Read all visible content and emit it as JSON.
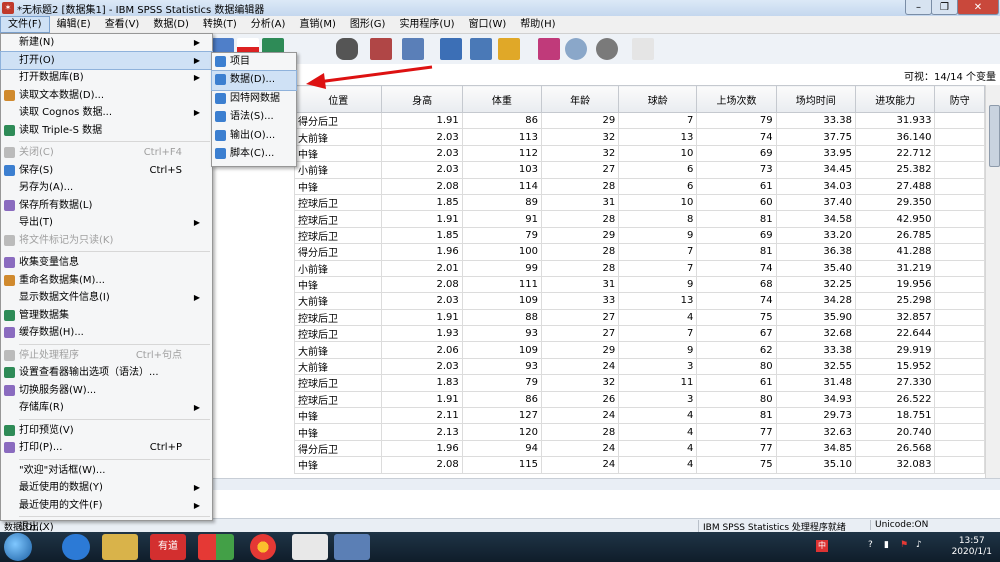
{
  "window": {
    "title": "*无标题2 [数据集1] - IBM SPSS Statistics 数据编辑器"
  },
  "menubar": [
    "文件(F)",
    "编辑(E)",
    "查看(V)",
    "数据(D)",
    "转换(T)",
    "分析(A)",
    "直销(M)",
    "图形(G)",
    "实用程序(U)",
    "窗口(W)",
    "帮助(H)"
  ],
  "visible_vars": "可视：14/14 个变量",
  "file_menu": [
    {
      "label": "新建(N)",
      "sub": true
    },
    {
      "label": "打开(O)",
      "sub": true,
      "highlight": true
    },
    {
      "label": "打开数据库(B)",
      "sub": true
    },
    {
      "label": "读取文本数据(D)...",
      "icon": true
    },
    {
      "label": "读取 Cognos 数据...",
      "sub": true
    },
    {
      "label": "读取 Triple-S 数据",
      "icon": true
    },
    {
      "sep": true
    },
    {
      "label": "关闭(C)",
      "shortcut": "Ctrl+F4",
      "disabled": true,
      "icon": true
    },
    {
      "label": "保存(S)",
      "shortcut": "Ctrl+S",
      "icon": true
    },
    {
      "label": "另存为(A)..."
    },
    {
      "label": "保存所有数据(L)",
      "icon": true
    },
    {
      "label": "导出(T)",
      "sub": true
    },
    {
      "label": "将文件标记为只读(K)",
      "disabled": true,
      "icon": true
    },
    {
      "sep": true
    },
    {
      "label": "收集变量信息",
      "icon": true
    },
    {
      "label": "重命名数据集(M)...",
      "icon": true
    },
    {
      "label": "显示数据文件信息(I)",
      "sub": true
    },
    {
      "label": "管理数据集",
      "icon": true
    },
    {
      "label": "缓存数据(H)...",
      "icon": true
    },
    {
      "sep": true
    },
    {
      "label": "停止处理程序",
      "shortcut": "Ctrl+句点",
      "disabled": true,
      "icon": true
    },
    {
      "label": "设置查看器输出选项（语法）...",
      "icon": true
    },
    {
      "label": "切换服务器(W)...",
      "icon": true
    },
    {
      "label": "存储库(R)",
      "sub": true
    },
    {
      "sep": true
    },
    {
      "label": "打印预览(V)",
      "icon": true
    },
    {
      "label": "打印(P)...",
      "shortcut": "Ctrl+P",
      "icon": true
    },
    {
      "sep": true
    },
    {
      "label": "\"欢迎\"对话框(W)..."
    },
    {
      "label": "最近使用的数据(Y)",
      "sub": true
    },
    {
      "label": "最近使用的文件(F)",
      "sub": true
    },
    {
      "sep": true
    },
    {
      "label": "退出(X)"
    }
  ],
  "open_submenu": [
    {
      "label": "项目"
    },
    {
      "label": "数据(D)...",
      "highlight": true
    },
    {
      "label": "因特网数据"
    },
    {
      "label": "语法(S)..."
    },
    {
      "label": "输出(O)..."
    },
    {
      "label": "脚本(C)..."
    }
  ],
  "columns": [
    "位置",
    "身高",
    "体重",
    "年龄",
    "球龄",
    "上场次数",
    "场均时间",
    "进攻能力",
    "防守"
  ],
  "rows": [
    [
      "得分后卫",
      "1.91",
      "86",
      "29",
      "7",
      "79",
      "33.38",
      "31.933"
    ],
    [
      "大前锋",
      "2.03",
      "113",
      "32",
      "13",
      "74",
      "37.75",
      "36.140"
    ],
    [
      "中锋",
      "2.03",
      "112",
      "32",
      "10",
      "69",
      "33.95",
      "22.712"
    ],
    [
      "小前锋",
      "2.03",
      "103",
      "27",
      "6",
      "73",
      "34.45",
      "25.382"
    ],
    [
      "中锋",
      "2.08",
      "114",
      "28",
      "6",
      "61",
      "34.03",
      "27.488"
    ],
    [
      "控球后卫",
      "1.85",
      "89",
      "31",
      "10",
      "60",
      "37.40",
      "29.350"
    ],
    [
      "控球后卫",
      "1.91",
      "91",
      "28",
      "8",
      "81",
      "34.58",
      "42.950"
    ],
    [
      "控球后卫",
      "1.85",
      "79",
      "29",
      "9",
      "69",
      "33.20",
      "26.785"
    ],
    [
      "得分后卫",
      "1.96",
      "100",
      "28",
      "7",
      "81",
      "36.38",
      "41.288"
    ],
    [
      "小前锋",
      "2.01",
      "99",
      "28",
      "7",
      "74",
      "35.40",
      "31.219"
    ],
    [
      "中锋",
      "2.08",
      "111",
      "31",
      "9",
      "68",
      "32.25",
      "19.956"
    ],
    [
      "大前锋",
      "2.03",
      "109",
      "33",
      "13",
      "74",
      "34.28",
      "25.298"
    ],
    [
      "控球后卫",
      "1.91",
      "88",
      "27",
      "4",
      "75",
      "35.90",
      "32.857"
    ],
    [
      "控球后卫",
      "1.93",
      "93",
      "27",
      "7",
      "67",
      "32.68",
      "22.644"
    ],
    [
      "大前锋",
      "2.06",
      "109",
      "29",
      "9",
      "62",
      "33.38",
      "29.919"
    ],
    [
      "大前锋",
      "2.03",
      "93",
      "24",
      "3",
      "80",
      "32.55",
      "15.952"
    ],
    [
      "控球后卫",
      "1.83",
      "79",
      "32",
      "11",
      "61",
      "31.48",
      "27.330"
    ],
    [
      "控球后卫",
      "1.91",
      "86",
      "26",
      "3",
      "80",
      "34.93",
      "26.522"
    ],
    [
      "中锋",
      "2.11",
      "127",
      "24",
      "4",
      "81",
      "29.73",
      "18.751"
    ],
    [
      "中锋",
      "2.13",
      "120",
      "28",
      "4",
      "77",
      "32.63",
      "20.740"
    ],
    [
      "得分后卫",
      "1.96",
      "94",
      "24",
      "4",
      "77",
      "34.85",
      "26.568"
    ],
    [
      "中锋",
      "2.08",
      "115",
      "24",
      "4",
      "75",
      "35.10",
      "32.083"
    ]
  ],
  "status": {
    "left": "数据(D)...",
    "mid": "IBM SPSS Statistics 处理程序就绪",
    "right": "Unicode:ON"
  },
  "tray": {
    "time": "13:57",
    "date": "2020/1/1",
    "lang": "中"
  },
  "taskbar": [
    "",
    "",
    "有道",
    "",
    "",
    "",
    ""
  ]
}
